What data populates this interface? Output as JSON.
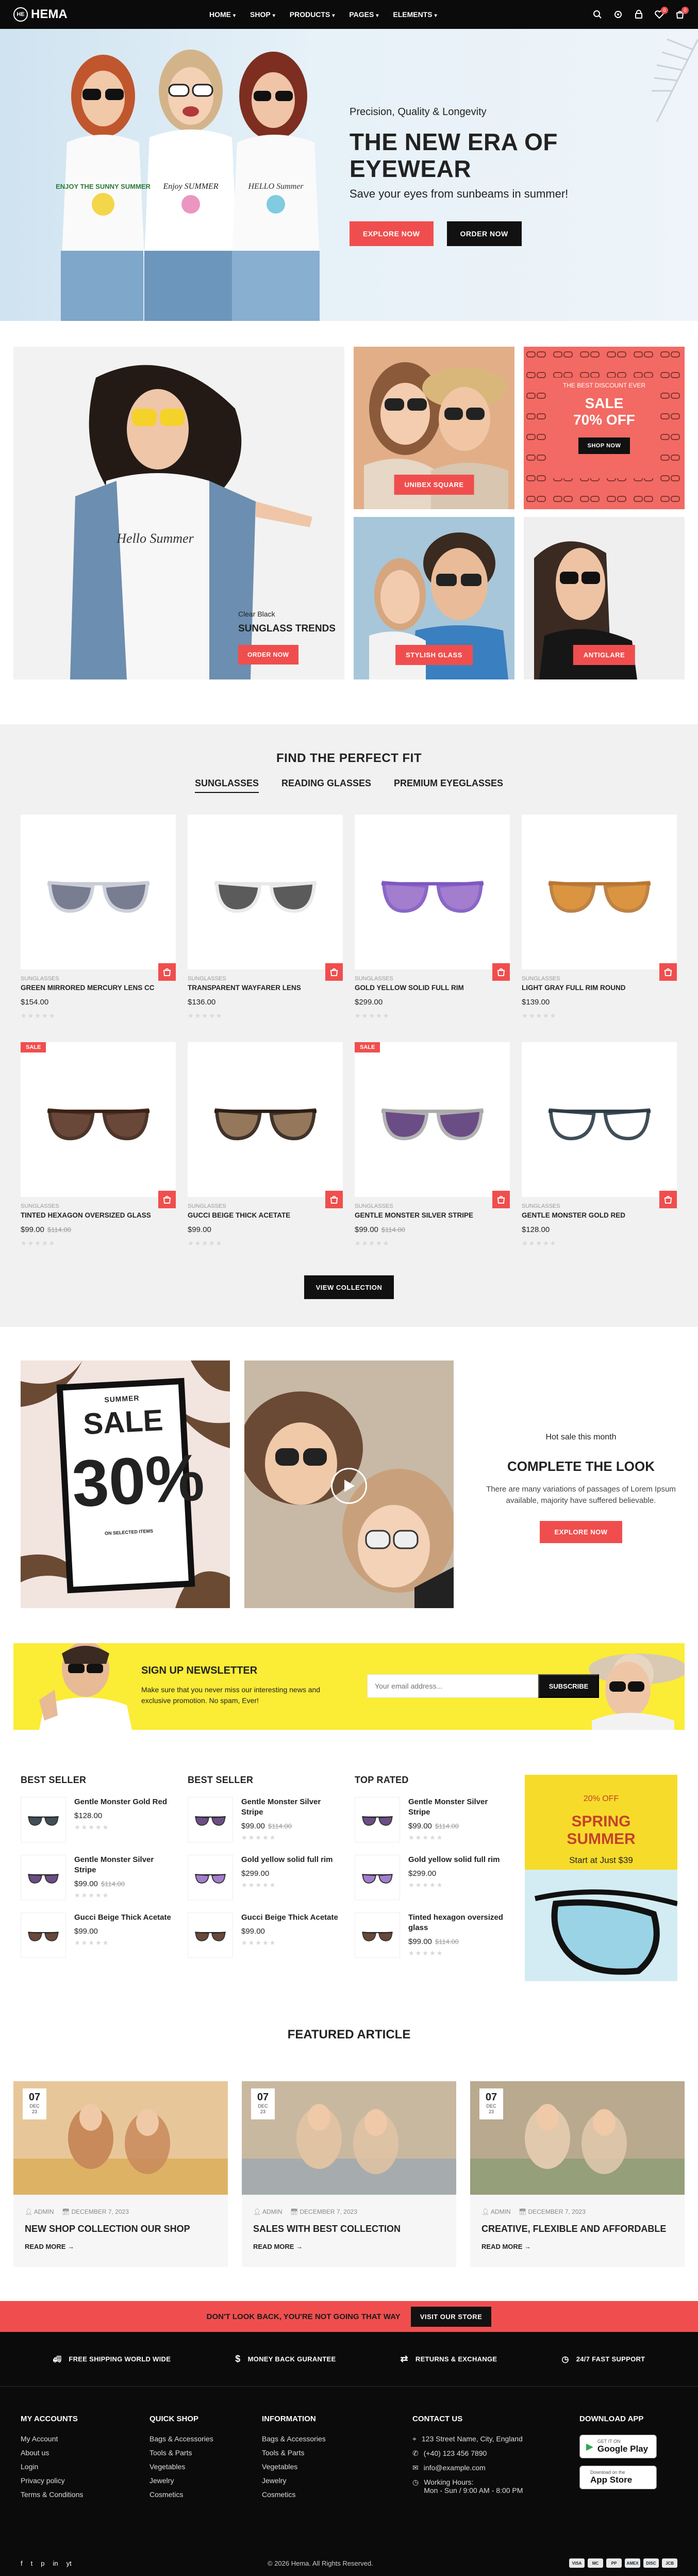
{
  "header": {
    "brand": "HEMA",
    "brand_mark": "HE",
    "nav": [
      "HOME",
      "SHOP",
      "PRODUCTS",
      "PAGES",
      "ELEMENTS"
    ],
    "cart_count": "0",
    "wishlist_count": "0"
  },
  "hero": {
    "pre": "Precision, Quality & Longevity",
    "title_line1": "THE NEW ERA OF",
    "title_line2": "EYEWEAR",
    "subtitle": "Save your eyes from sunbeams in summer!",
    "btn_explore": "EXPLORE NOW",
    "btn_order": "ORDER NOW",
    "shirt1": "ENJOY THE SUNNY SUMMER",
    "shirt2": "Enjoy SUMMER",
    "shirt3": "HELLO Summer"
  },
  "banners": {
    "trend_small": "Clear Black",
    "trend_title": "SUNGLASS TRENDS",
    "trend_btn": "ORDER NOW",
    "trend_shirt": "Hello Summer",
    "tag_unibex": "UNIBEX SQUARE",
    "tag_stylish": "STYLISH GLASS",
    "tag_antiglare": "ANTIGLARE",
    "sale_small": "THE BEST DISCOUNT EVER",
    "sale_title": "SALE",
    "sale_off": "70% OFF",
    "sale_btn": "SHOP NOW"
  },
  "collection": {
    "title": "FIND THE PERFECT FIT",
    "tabs": [
      "SUNGLASSES",
      "READING GLASSES",
      "PREMIUM EYEGLASSES"
    ],
    "view_btn": "VIEW COLLECTION",
    "sale_label": "SALE",
    "products": [
      {
        "cat": "SUNGLASSES",
        "name": "GREEN MIRRORED MERCURY LENS CC",
        "price": "$154.00",
        "old": "",
        "sale": false,
        "color": "#6a6f86",
        "frame": "#c9cbd6"
      },
      {
        "cat": "SUNGLASSES",
        "name": "TRANSPARENT WAYFARER LENS",
        "price": "$136.00",
        "old": "",
        "sale": false,
        "color": "#4a4a4a",
        "frame": "#e8e8e8"
      },
      {
        "cat": "SUNGLASSES",
        "name": "GOLD YELLOW SOLID FULL RIM",
        "price": "$299.00",
        "old": "",
        "sale": false,
        "color": "#9a6fc9",
        "frame": "#7e57c2"
      },
      {
        "cat": "SUNGLASSES",
        "name": "LIGHT GRAY FULL RIM ROUND",
        "price": "$139.00",
        "old": "",
        "sale": false,
        "color": "#d88a2c",
        "frame": "#b87533"
      },
      {
        "cat": "SUNGLASSES",
        "name": "TINTED HEXAGON OVERSIZED GLASS",
        "price": "$99.00",
        "old": "$114.00",
        "sale": true,
        "color": "#5a3524",
        "frame": "#3a2014"
      },
      {
        "cat": "SUNGLASSES",
        "name": "GUCCI BEIGE THICK ACETATE",
        "price": "$99.00",
        "old": "",
        "sale": false,
        "color": "#8a6a4a",
        "frame": "#2b1d14"
      },
      {
        "cat": "SUNGLASSES",
        "name": "GENTLE MONSTER SILVER STRIPE",
        "price": "$99.00",
        "old": "$114.00",
        "sale": true,
        "color": "#5b3a7a",
        "frame": "#aaa"
      },
      {
        "cat": "SUNGLASSES",
        "name": "GENTLE MONSTER GOLD RED",
        "price": "$128.00",
        "old": "",
        "sale": false,
        "color": "#ffffff",
        "frame": "#2c3b44"
      }
    ]
  },
  "look": {
    "sale_small": "SUMMER",
    "sale_big": "SALE",
    "sale_pct": "30%",
    "sale_foot": "ON SELECTED ITEMS",
    "hot": "Hot sale this month",
    "title": "COMPLETE THE LOOK",
    "desc": "There are many variations of passages of Lorem Ipsum available, majority have suffered believable.",
    "btn": "EXPLORE NOW"
  },
  "newsletter": {
    "title": "SIGN UP NEWSLETTER",
    "desc": "Make sure that you never miss our interesting news and exclusive promotion. No spam, Ever!",
    "placeholder": "Your email address...",
    "btn": "SUBSCRIBE"
  },
  "lists": [
    {
      "title": "BEST SELLER",
      "items": [
        {
          "name": "Gentle Monster Gold Red",
          "price": "$128.00",
          "old": "",
          "color": "#2c3b44"
        },
        {
          "name": "Gentle Monster Silver Stripe",
          "price": "$99.00",
          "old": "$114.00",
          "color": "#5b3a7a"
        },
        {
          "name": "Gucci Beige Thick Acetate",
          "price": "$99.00",
          "old": "",
          "color": "#5a3524"
        }
      ]
    },
    {
      "title": "BEST SELLER",
      "items": [
        {
          "name": "Gentle Monster Silver Stripe",
          "price": "$99.00",
          "old": "$114.00",
          "color": "#5b3a7a"
        },
        {
          "name": "Gold yellow solid full rim",
          "price": "$299.00",
          "old": "",
          "color": "#9a6fc9"
        },
        {
          "name": "Gucci Beige Thick Acetate",
          "price": "$99.00",
          "old": "",
          "color": "#5a3524"
        }
      ]
    },
    {
      "title": "TOP RATED",
      "items": [
        {
          "name": "Gentle Monster Silver Stripe",
          "price": "$99.00",
          "old": "$114.00",
          "color": "#5b3a7a"
        },
        {
          "name": "Gold yellow solid full rim",
          "price": "$299.00",
          "old": "",
          "color": "#9a6fc9"
        },
        {
          "name": "Tinted hexagon oversized glass",
          "price": "$99.00",
          "old": "$114.00",
          "color": "#5a3524"
        }
      ]
    }
  ],
  "spring": {
    "off": "20% OFF",
    "title_line1": "SPRING",
    "title_line2": "SUMMER",
    "start": "Start at Just $39"
  },
  "articles": {
    "title": "FEATURED ARTICLE",
    "read_more": "READ MORE",
    "items": [
      {
        "day": "07",
        "mon": "DEC",
        "yr": "23",
        "author": "ADMIN",
        "date": "DECEMBER 7, 2023",
        "title": "NEW SHOP COLLECTION OUR SHOP"
      },
      {
        "day": "07",
        "mon": "DEC",
        "yr": "23",
        "author": "ADMIN",
        "date": "DECEMBER 7, 2023",
        "title": "SALES WITH BEST COLLECTION"
      },
      {
        "day": "07",
        "mon": "DEC",
        "yr": "23",
        "author": "ADMIN",
        "date": "DECEMBER 7, 2023",
        "title": "CREATIVE, FLEXIBLE AND AFFORDABLE"
      }
    ]
  },
  "promo": {
    "text": "DON'T LOOK BACK, YOU'RE NOT GOING THAT WAY",
    "btn": "VISIT OUR STORE"
  },
  "footer": {
    "features": [
      "FREE SHIPPING WORLD WIDE",
      "MONEY BACK GURANTEE",
      "RETURNS & EXCHANGE",
      "24/7 FAST SUPPORT"
    ],
    "accounts_title": "MY ACCOUNTS",
    "accounts": [
      "My Account",
      "About us",
      "Login",
      "Privacy policy",
      "Terms & Conditions"
    ],
    "quick_title": "QUICK SHOP",
    "quick": [
      "Bags & Accessories",
      "Tools & Parts",
      "Vegetables",
      "Jewelry",
      "Cosmetics"
    ],
    "info_title": "INFORMATION",
    "info": [
      "Bags & Accessories",
      "Tools & Parts",
      "Vegetables",
      "Jewelry",
      "Cosmetics"
    ],
    "contact_title": "CONTACT US",
    "address": "123 Street Name, City, England",
    "phone": "(+40) 123 456 7890",
    "email": "info@example.com",
    "hours_label": "Working Hours:",
    "hours": "Mon - Sun / 9:00 AM - 8:00 PM",
    "app_title": "DOWNLOAD APP",
    "gp_small": "GET IT ON",
    "gp_big": "Google Play",
    "as_small": "Download on the",
    "as_big": "App Store",
    "copyright": "© 2026 Hema. All Rights Reserved.",
    "social": [
      "f",
      "t",
      "p",
      "in",
      "yt"
    ],
    "payments": [
      "VISA",
      "MC",
      "PP",
      "AMEX",
      "DISC",
      "JCB"
    ]
  },
  "colors": {
    "accent": "#f04e4e",
    "dark": "#0b0b0b",
    "yellow": "#fbec36"
  }
}
